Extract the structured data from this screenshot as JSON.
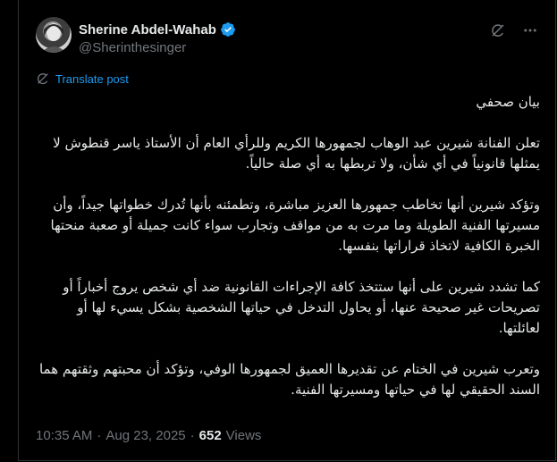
{
  "author": {
    "name": "Sherine Abdel-Wahab",
    "handle": "@Sherinthesinger"
  },
  "actions": {
    "translate_label": "Translate post"
  },
  "post": {
    "paragraphs": [
      "بيان صحفي",
      "تعلن الفنانة شيرين عبد الوهاب لجمهورها الكريم وللرأي العام أن الأستاذ ياسر قنطوش لا يمثلها قانونياً في أي شأن، ولا تربطها به أي صلة حالياً.",
      "وتؤكد شيرين أنها تخاطب جمهورها العزيز مباشرة، وتطمئنه بأنها تُدرك خطواتها جيداً، وأن مسيرتها الفنية الطويلة وما مرت به من مواقف وتجارب سواء كانت جميلة أو صعبة منحتها الخبرة الكافية لاتخاذ قراراتها بنفسها.",
      "كما تشدد شيرين على أنها ستتخذ كافة الإجراءات القانونية ضد أي شخص يروج أخباراً أو تصريحات غير صحيحة عنها، أو يحاول التدخل في حياتها الشخصية بشكل يسيء لها أو لعائلتها.",
      "وتعرب شيرين في الختام عن تقديرها العميق لجمهورها الوفي، وتؤكد أن محبتهم وثقتهم هما السند الحقيقي لها في حياتها ومسيرتها الفنية."
    ]
  },
  "meta": {
    "time": "10:35 AM",
    "sep": "·",
    "date": "Aug 23, 2025",
    "views_count": "652",
    "views_label": "Views"
  },
  "icons": {
    "verified": "verified-badge-icon",
    "grok": "grok-icon",
    "more": "more-icon",
    "translate": "translate-icon"
  },
  "colors": {
    "background": "#000000",
    "text": "#e7e9ea",
    "secondary": "#71767b",
    "accent": "#1d9bf0"
  }
}
